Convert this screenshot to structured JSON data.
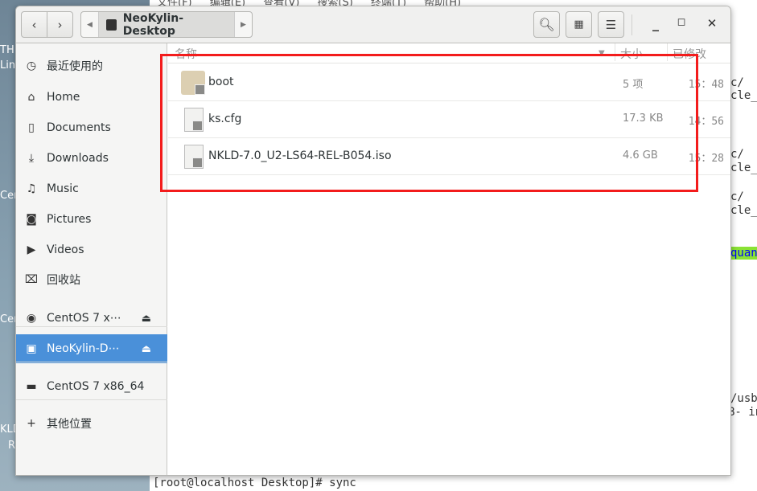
{
  "background": {
    "desktop_labels": [
      "TH",
      "Linu",
      "Cen",
      "Cen",
      "KLD",
      "R"
    ],
    "terminal_menu": "文件(F) 编辑(E) 查看(V) 搜索(S) 终端(T) 帮助(H)",
    "terminal_lines": [
      "c/",
      "cle_",
      "c/",
      "cle_",
      "c/",
      "cle_",
      "quan",
      "/usb",
      "B- in"
    ],
    "terminal_prompt": "[root@localhost Desktop]# sync"
  },
  "header": {
    "location": "NeoKylin-Desktop",
    "back_icon": "chevron-left",
    "forward_icon": "chevron-right",
    "search_icon": "search",
    "view_icon": "grid",
    "menu_icon": "hamburger"
  },
  "sidebar": {
    "items": [
      {
        "label": "最近使用的",
        "icon": "clock"
      },
      {
        "label": "Home",
        "icon": "home"
      },
      {
        "label": "Documents",
        "icon": "document"
      },
      {
        "label": "Downloads",
        "icon": "download"
      },
      {
        "label": "Music",
        "icon": "music"
      },
      {
        "label": "Pictures",
        "icon": "camera"
      },
      {
        "label": "Videos",
        "icon": "video"
      },
      {
        "label": "回收站",
        "icon": "trash"
      },
      {
        "label": "CentOS 7 x⋯",
        "icon": "disc",
        "eject": true
      },
      {
        "label": "NeoKylin-D⋯",
        "icon": "drive",
        "eject": true,
        "selected": true
      },
      {
        "label": "CentOS 7 x86_64",
        "icon": "folder"
      },
      {
        "label": "其他位置",
        "icon": "plus"
      }
    ]
  },
  "columns": {
    "name": "名称",
    "size": "大小",
    "modified": "已修改"
  },
  "files": [
    {
      "name": "boot",
      "size": "5 项",
      "modified": "15：48",
      "type": "folder"
    },
    {
      "name": "ks.cfg",
      "size": "17.3 KB",
      "modified": "14：56",
      "type": "text"
    },
    {
      "name": "NKLD-7.0_U2-LS64-REL-B054.iso",
      "size": "4.6 GB",
      "modified": "15：28",
      "type": "disc-image"
    }
  ],
  "colors": {
    "selection": "#4a90d9",
    "annotation": "#f31c1c"
  }
}
